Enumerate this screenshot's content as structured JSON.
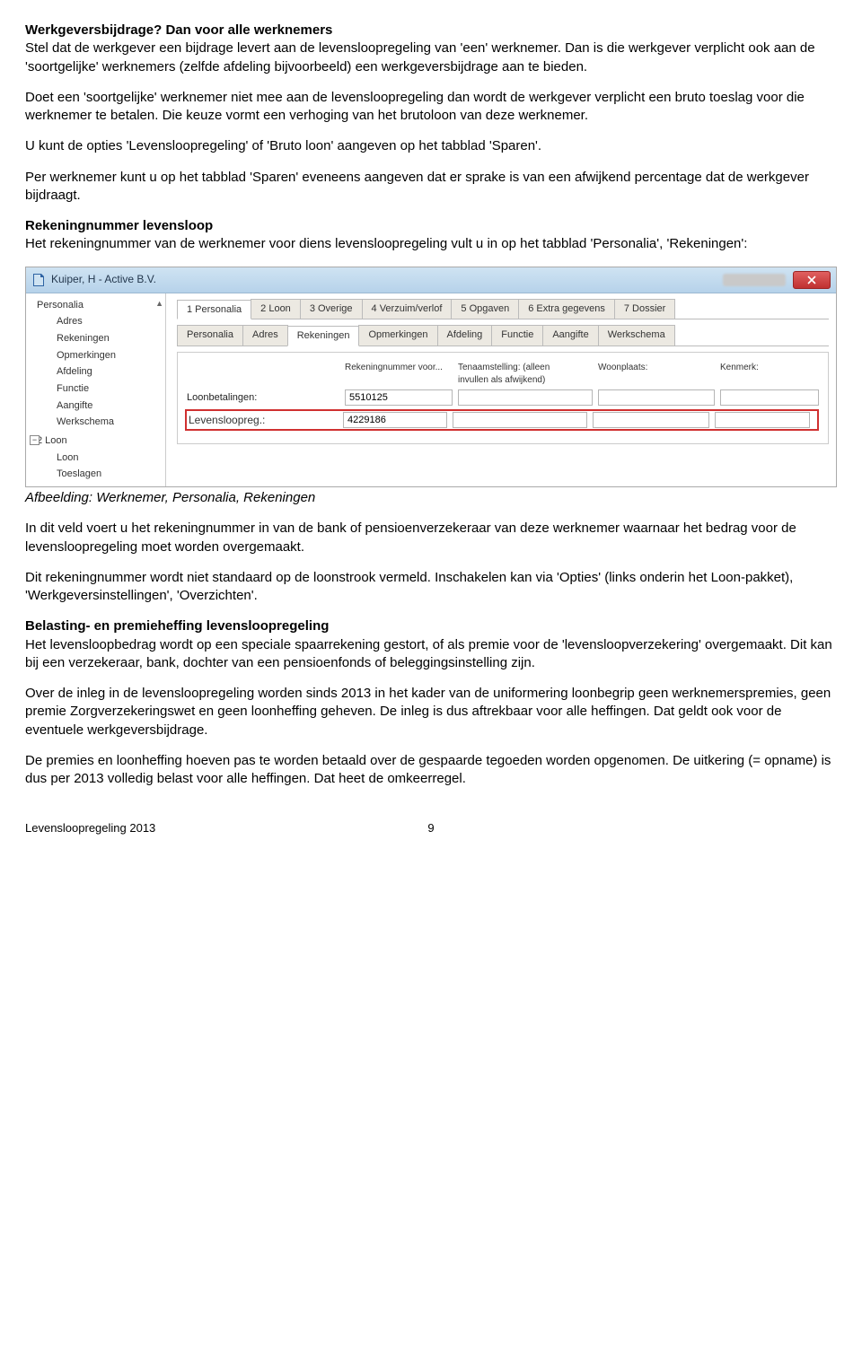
{
  "doc": {
    "h1": "Werkgeversbijdrage? Dan voor alle werknemers",
    "p1": "Stel dat de werkgever een bijdrage levert aan de levensloopregeling van 'een' werknemer. Dan is die werkgever verplicht ook aan de 'soortgelijke' werknemers (zelfde afdeling bijvoorbeeld) een werkgeversbijdrage aan te bieden.",
    "p2": "Doet een 'soortgelijke' werknemer niet mee aan de levensloopregeling dan wordt de werkgever verplicht een bruto toeslag voor die werknemer te betalen. Die keuze vormt een verhoging van het brutoloon van deze werknemer.",
    "p3": "U kunt de opties 'Levensloopregeling' of 'Bruto loon' aangeven op het tabblad 'Sparen'.",
    "p4": "Per werknemer kunt u op het tabblad 'Sparen' eveneens aangeven dat er sprake is van een afwijkend percentage dat de werkgever bijdraagt.",
    "h2": "Rekeningnummer levensloop",
    "p5": "Het rekeningnummer van de werknemer voor diens levensloopregeling vult u in op het tabblad 'Personalia', 'Rekeningen':",
    "caption": "Afbeelding: Werknemer, Personalia, Rekeningen",
    "p6": "In dit veld voert u het rekeningnummer in van de bank of pensioenverzekeraar van deze werknemer waarnaar het bedrag voor de levensloopregeling moet worden overgemaakt.",
    "p7": "Dit rekeningnummer wordt niet standaard op de loonstrook vermeld. Inschakelen kan via 'Opties' (links onderin het Loon-pakket), 'Werkgeversinstellingen', 'Overzichten'.",
    "h3": "Belasting- en premieheffing levensloopregeling",
    "p8": "Het levensloopbedrag wordt op een speciale spaarrekening gestort, of als premie voor de 'levensloopverzekering' overgemaakt. Dit kan bij een verzekeraar, bank, dochter van een pensioenfonds of beleggingsinstelling zijn.",
    "p9": "Over de inleg in de levensloopregeling worden sinds 2013 in het kader van de uniformering loonbegrip geen werknemerspremies, geen premie Zorgverzekeringswet en geen loonheffing geheven. De inleg is dus aftrekbaar voor alle heffingen. Dat geldt ook voor de eventuele werkgeversbijdrage.",
    "p10": "De premies en loonheffing hoeven pas te worden betaald over de gespaarde tegoeden worden opgenomen. De uitkering (= opname) is dus per 2013 volledig belast voor alle heffingen. Dat heet de omkeerregel.",
    "footer_left": "Levensloopregeling 2013",
    "footer_page": "9"
  },
  "shot": {
    "title": "Kuiper, H - Active B.V.",
    "tree": {
      "root1": "Personalia",
      "children1": [
        "Adres",
        "Rekeningen",
        "Opmerkingen",
        "Afdeling",
        "Functie",
        "Aangifte",
        "Werkschema"
      ],
      "root2": "2 Loon",
      "children2": [
        "Loon",
        "Toeslagen"
      ]
    },
    "main_tabs": [
      "1 Personalia",
      "2 Loon",
      "3 Overige",
      "4 Verzuim/verlof",
      "5 Opgaven",
      "6 Extra gegevens",
      "7 Dossier"
    ],
    "sub_tabs": [
      "Personalia",
      "Adres",
      "Rekeningen",
      "Opmerkingen",
      "Afdeling",
      "Functie",
      "Aangifte",
      "Werkschema"
    ],
    "headers": {
      "col1": "Rekeningnummer voor...",
      "col2a": "Tenaamstelling: (alleen",
      "col2b": "invullen als afwijkend)",
      "col3": "Woonplaats:",
      "col4": "Kenmerk:"
    },
    "rows": [
      {
        "label": "Loonbetalingen:",
        "value": "5510125"
      },
      {
        "label": "Levensloopreg.:",
        "value": "4229186"
      }
    ]
  }
}
